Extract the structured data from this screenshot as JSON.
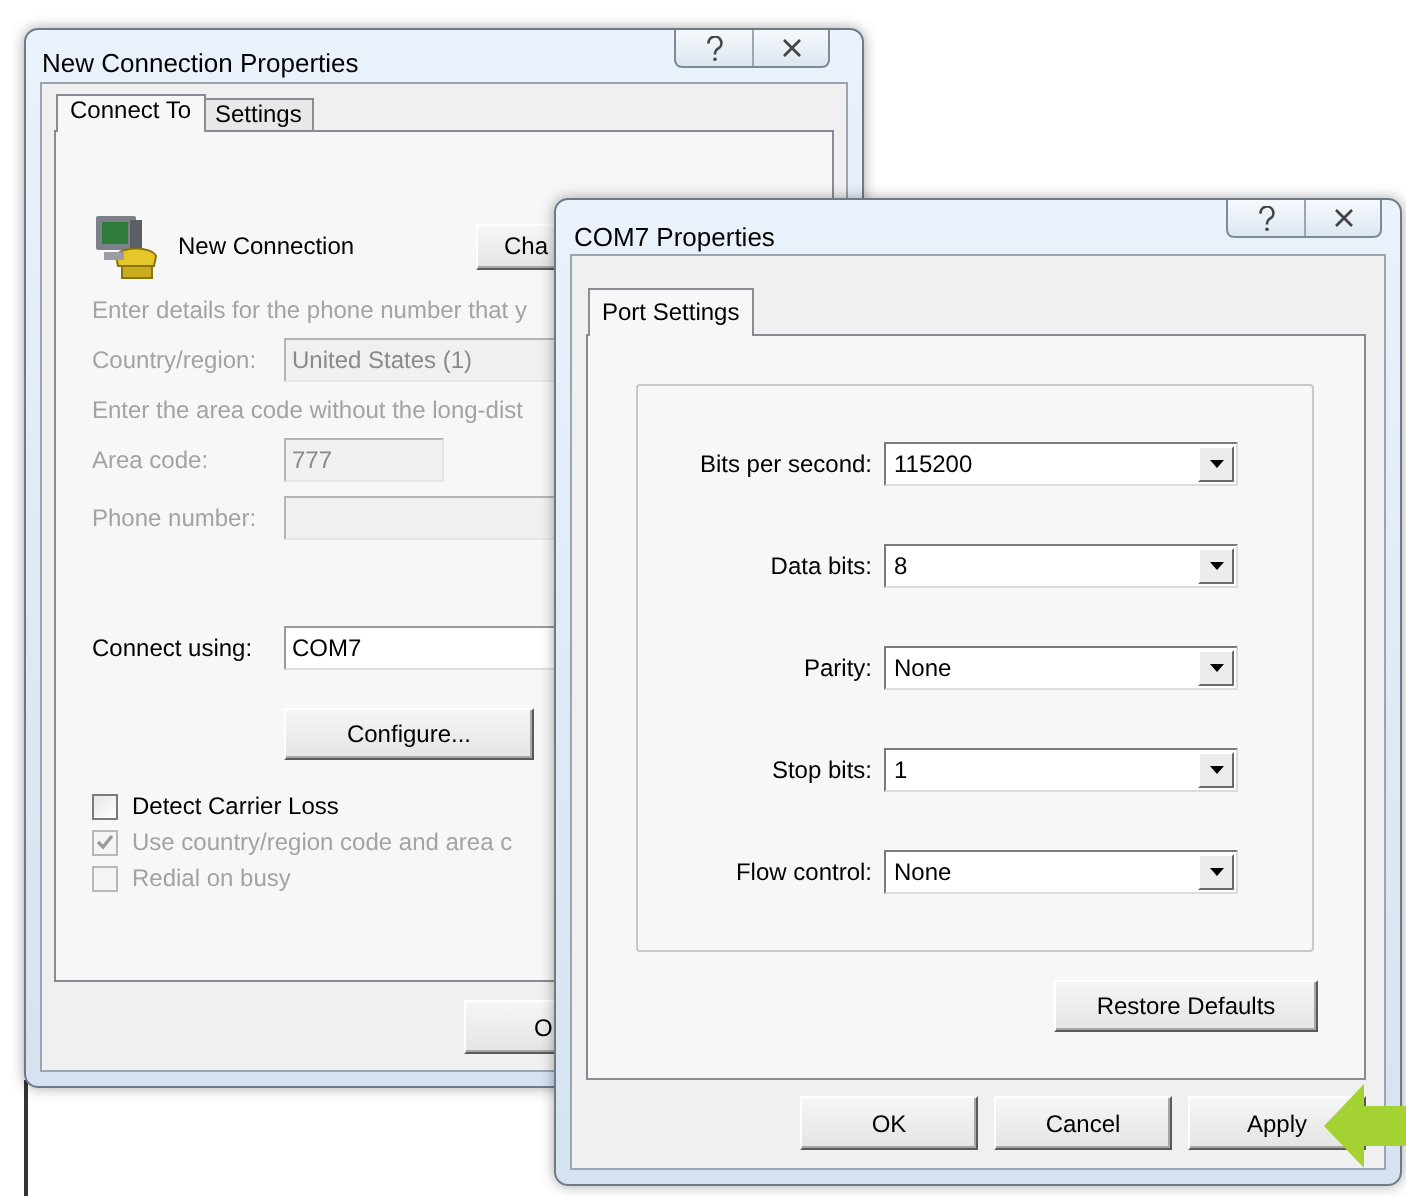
{
  "new_connection_window": {
    "title": "New Connection Properties",
    "tabs": [
      {
        "label": "Connect To",
        "selected": true
      },
      {
        "label": "Settings",
        "selected": false
      }
    ],
    "connection": {
      "name": "New Connection",
      "change_icon_button": "Cha"
    },
    "form": [
      {
        "kind": "hint",
        "text": "Enter details for the phone number that y"
      },
      {
        "kind": "field",
        "label": "Country/region:",
        "value": "United States (1)",
        "disabled": true
      },
      {
        "kind": "hint",
        "text": "Enter the area code without the long-dist"
      },
      {
        "kind": "short-field",
        "label": "Area code:",
        "value": "777",
        "disabled": true
      },
      {
        "kind": "field",
        "label": "Phone number:",
        "disabled": true
      }
    ],
    "connect_using": {
      "label": "Connect using:",
      "value": "COM7"
    },
    "configure_button": "Configure...",
    "options": [
      {
        "label": "Detect Carrier Loss",
        "checked": false,
        "disabled": false
      },
      {
        "label": "Use country/region code and area c",
        "checked": true,
        "disabled": true
      },
      {
        "label": "Redial on busy",
        "checked": false,
        "disabled": true
      }
    ],
    "ok_button": "O"
  },
  "com7_window": {
    "title": "COM7 Properties",
    "tabs": [
      {
        "label": "Port Settings",
        "selected": true
      }
    ],
    "port_settings": [
      {
        "label": "Bits per second:",
        "value": "115200"
      },
      {
        "label": "Data bits:",
        "value": "8"
      },
      {
        "label": "Parity:",
        "value": "None"
      },
      {
        "label": "Stop bits:",
        "value": "1"
      },
      {
        "label": "Flow control:",
        "value": "None"
      }
    ],
    "restore_button": "Restore Defaults",
    "buttons": [
      "OK",
      "Cancel",
      "Apply"
    ]
  }
}
